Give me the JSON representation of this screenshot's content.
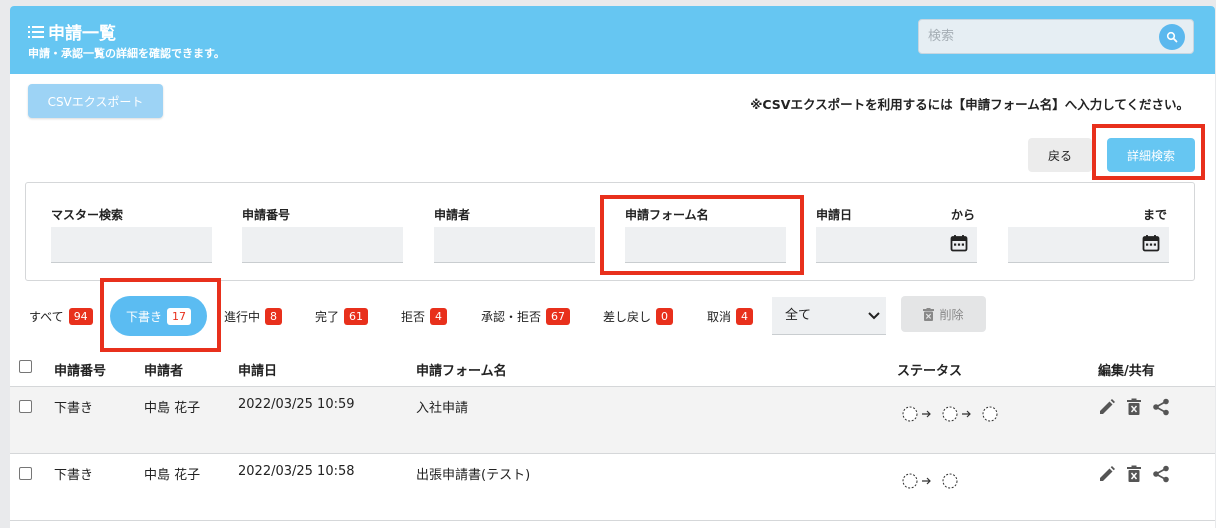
{
  "header": {
    "title": "申請一覧",
    "subtitle": "申請・承認一覧の詳細を確認できます。",
    "search_placeholder": "検索"
  },
  "toolbar": {
    "csv_label": "CSVエクスポート",
    "csv_note": "※CSVエクスポートを利用するには【申請フォーム名】へ入力してください。",
    "back_label": "戻る",
    "advanced_search_label": "詳細検索"
  },
  "filters": {
    "master_label": "マスター検索",
    "number_label": "申請番号",
    "applicant_label": "申請者",
    "form_label": "申請フォーム名",
    "date_label": "申請日",
    "from_label": "から",
    "to_label": "まで"
  },
  "tabs": [
    {
      "label": "すべて",
      "count": "94"
    },
    {
      "label": "下書き",
      "count": "17"
    },
    {
      "label": "進行中",
      "count": "8"
    },
    {
      "label": "完了",
      "count": "61"
    },
    {
      "label": "拒否",
      "count": "4"
    },
    {
      "label": "承認・拒否",
      "count": "67"
    },
    {
      "label": "差し戻し",
      "count": "0"
    },
    {
      "label": "取消",
      "count": "4"
    }
  ],
  "select_value": "全て",
  "delete_label": "削除",
  "table": {
    "columns": [
      "申請番号",
      "申請者",
      "申請日",
      "申請フォーム名",
      "ステータス",
      "編集/共有"
    ],
    "rows": [
      {
        "number": "下書き",
        "applicant": "中島 花子",
        "date": "2022/03/25 10:59",
        "form": "入社申請",
        "steps": 3
      },
      {
        "number": "下書き",
        "applicant": "中島 花子",
        "date": "2022/03/25 10:58",
        "form": "出張申請書(テスト)",
        "steps": 2
      }
    ]
  },
  "colors": {
    "header_bg": "#66c6f2",
    "accent": "#5bbcf2",
    "badge": "#e8301c",
    "highlight": "#e8301c"
  },
  "icons": [
    "list-icon",
    "search-icon",
    "calendar-icon",
    "trash-icon",
    "edit-icon",
    "delete-icon",
    "share-icon",
    "chevron-down-icon",
    "status-step-icon",
    "arrow-right-icon"
  ]
}
